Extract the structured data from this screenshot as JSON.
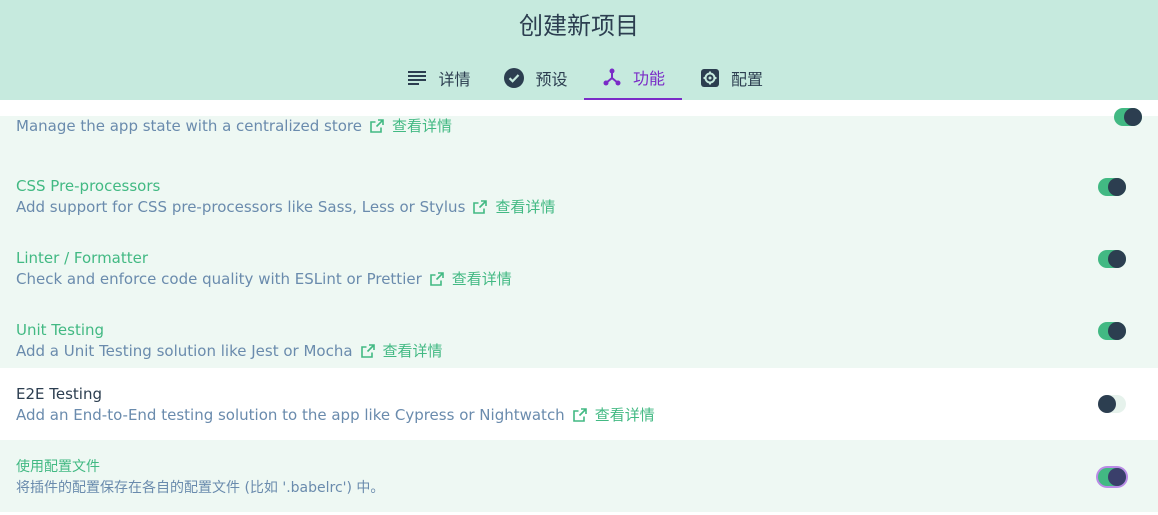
{
  "header": {
    "title": "创建新项目"
  },
  "tabs": [
    {
      "label": "详情",
      "icon": "details-list-icon",
      "active": false
    },
    {
      "label": "预设",
      "icon": "check-circle-icon",
      "active": false
    },
    {
      "label": "功能",
      "icon": "features-icon",
      "active": true
    },
    {
      "label": "配置",
      "icon": "gear-icon",
      "active": false
    }
  ],
  "features": [
    {
      "name": "",
      "description": "Manage the app state with a centralized store",
      "link": "查看详情",
      "enabled": true
    },
    {
      "name": "CSS Pre-processors",
      "description": "Add support for CSS pre-processors like Sass, Less or Stylus",
      "link": "查看详情",
      "enabled": true
    },
    {
      "name": "Linter / Formatter",
      "description": "Check and enforce code quality with ESLint or Prettier",
      "link": "查看详情",
      "enabled": true
    },
    {
      "name": "Unit Testing",
      "description": "Add a Unit Testing solution like Jest or Mocha",
      "link": "查看详情",
      "enabled": true
    },
    {
      "name": "E2E Testing",
      "description": "Add an End-to-End testing solution to the app like Cypress or Nightwatch",
      "link": "查看详情",
      "enabled": false
    },
    {
      "name": "使用配置文件",
      "description": "将插件的配置保存在各自的配置文件 (比如 '.babelrc') 中。",
      "enabled": true
    }
  ],
  "colors": {
    "header_bg": "#c6eade",
    "accent_green": "#42b983",
    "accent_purple": "#7a2cc7",
    "text_dark": "#2c3e50",
    "text_muted": "#6a8bad"
  }
}
